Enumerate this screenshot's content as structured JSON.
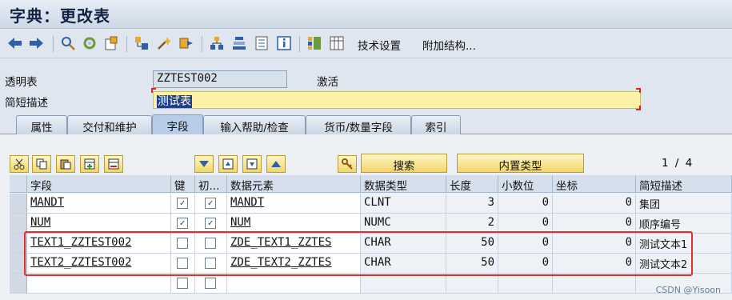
{
  "window": {
    "title": "字典：更改表"
  },
  "toolbar": {
    "tech_settings": "技术设置",
    "append_structure": "附加结构..."
  },
  "header": {
    "table_label": "透明表",
    "table_value": "ZZTEST002",
    "status": "激活",
    "desc_label": "简短描述",
    "desc_value": "测试表"
  },
  "tabs": [
    "属性",
    "交付和维护",
    "字段",
    "输入帮助/检查",
    "货币/数量字段",
    "索引"
  ],
  "buttons": {
    "search": "搜索",
    "builtin_type": "内置类型"
  },
  "pager": {
    "current": "1",
    "separator": "/",
    "total": "4"
  },
  "columns": [
    "字段",
    "键",
    "初...",
    "数据元素",
    "数据类型",
    "长度",
    "小数位",
    "坐标",
    "简短描述"
  ],
  "rows": [
    {
      "field": "MANDT",
      "key": true,
      "init": true,
      "data_element": "MANDT",
      "data_type": "CLNT",
      "length": "3",
      "decimals": "0",
      "coord": "0",
      "desc": "集团"
    },
    {
      "field": "NUM",
      "key": true,
      "init": true,
      "data_element": "NUM",
      "data_type": "NUMC",
      "length": "2",
      "decimals": "0",
      "coord": "0",
      "desc": "顺序编号"
    },
    {
      "field": "TEXT1_ZZTEST002",
      "key": false,
      "init": false,
      "data_element": "ZDE_TEXT1_ZZTES",
      "data_type": "CHAR",
      "length": "50",
      "decimals": "0",
      "coord": "0",
      "desc": "测试文本1"
    },
    {
      "field": "TEXT2_ZZTEST002",
      "key": false,
      "init": false,
      "data_element": "ZDE_TEXT2_ZZTES",
      "data_type": "CHAR",
      "length": "50",
      "decimals": "0",
      "coord": "0",
      "desc": "测试文本2"
    },
    {
      "field": "",
      "key": false,
      "init": false,
      "data_element": "",
      "data_type": "",
      "length": "",
      "decimals": "",
      "coord": "",
      "desc": ""
    }
  ],
  "watermark": "CSDN @Yisoon",
  "colors": {
    "highlight": "#e03030",
    "active_tab": "#b7cce6",
    "button": "#f2d66a",
    "desc_field": "#fbf1a8"
  },
  "icons": [
    "back-icon",
    "forward-icon",
    "other-object-icon",
    "display-change-icon",
    "activate-icon",
    "where-used-icon",
    "check-icon",
    "object-list-icon",
    "navigate-icon",
    "hierarchy-icon",
    "info-icon",
    "layout-icon",
    "table-contents-icon"
  ]
}
